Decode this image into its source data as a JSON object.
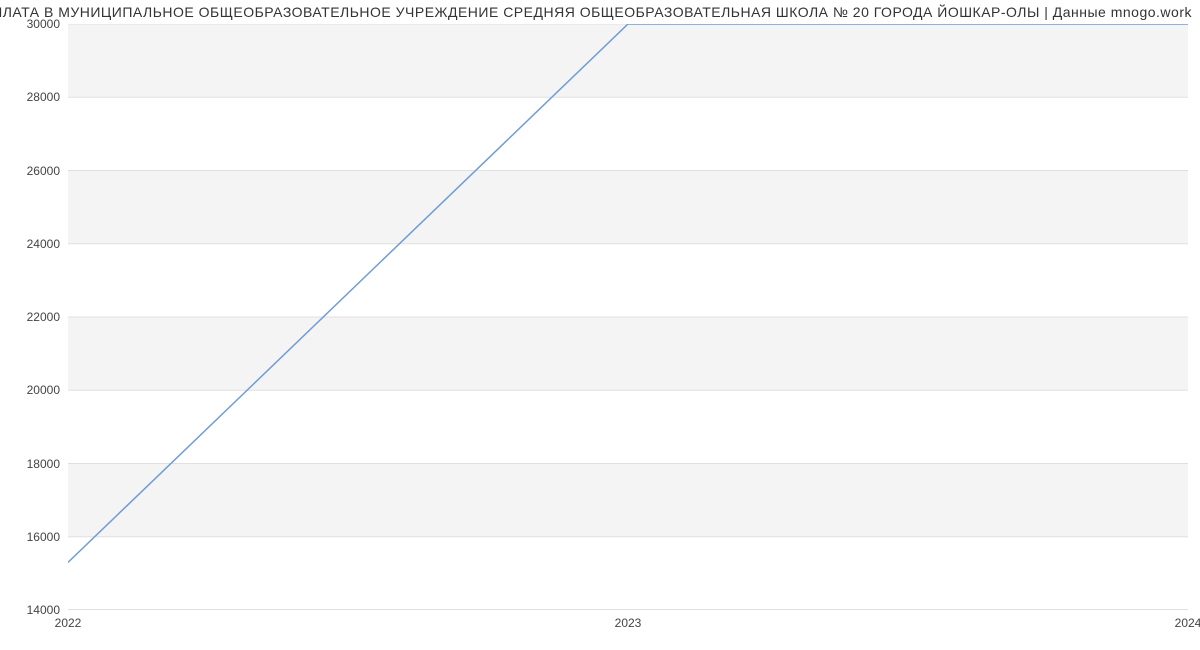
{
  "chart_data": {
    "type": "line",
    "title": "ЗАРПЛАТА В МУНИЦИПАЛЬНОЕ ОБЩЕОБРАЗОВАТЕЛЬНОЕ УЧРЕЖДЕНИЕ СРЕДНЯЯ ОБЩЕОБРАЗОВАТЕЛЬНАЯ ШКОЛА № 20 ГОРОДА ЙОШКАР-ОЛЫ | Данные mnogo.work",
    "x": [
      2022,
      2023,
      2024
    ],
    "values": [
      15300,
      30000,
      30000
    ],
    "xlabel": "",
    "ylabel": "",
    "y_ticks": [
      14000,
      16000,
      18000,
      20000,
      22000,
      24000,
      26000,
      28000,
      30000
    ],
    "x_ticks": [
      2022,
      2023,
      2024
    ],
    "ylim": [
      14000,
      30000
    ],
    "xlim": [
      2022,
      2024
    ],
    "grid": "horizontal-bands"
  }
}
